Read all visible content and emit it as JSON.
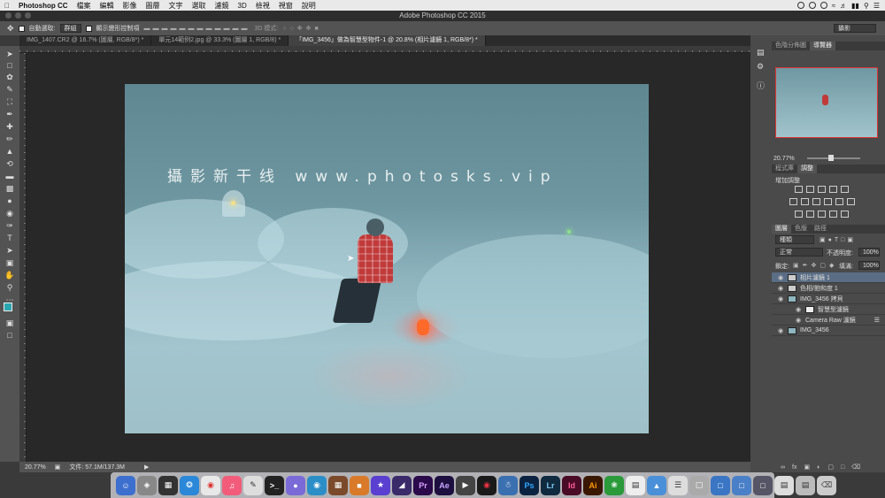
{
  "menubar": {
    "app_name": "Photoshop CC",
    "items": [
      "檔案",
      "編輯",
      "影像",
      "圖層",
      "文字",
      "選取",
      "濾鏡",
      "3D",
      "檢視",
      "視窗",
      "說明"
    ]
  },
  "window": {
    "title": "Adobe Photoshop CC 2015"
  },
  "options_bar": {
    "auto_select_label": "自動選取:",
    "auto_select_value": "群組",
    "transform_controls_label": "顯示變形控制項",
    "mode_3d_label": "3D 模式:",
    "workspace": "攝影"
  },
  "tabs": [
    {
      "label": "IMG_1407.CR2 @ 16.7% (圖層, RGB/8*) *"
    },
    {
      "label": "單元14範例2.jpg @ 33.3% (圖層 1, RGB/8) *"
    },
    {
      "label": "「IMG_3456」做為智慧型物件-1 @ 20.8% (相片濾鏡 1, RGB/8*) *"
    }
  ],
  "canvas": {
    "watermark": "攝影新干线 www.photosks.vip"
  },
  "status": {
    "zoom": "20.77%",
    "doc_label": "文件: 57.1M/137.3M"
  },
  "navigator": {
    "tabs": [
      "色階分佈圖",
      "導覽器"
    ],
    "zoom": "20.77%"
  },
  "adjustments": {
    "tabs": [
      "程式庫",
      "調整"
    ],
    "heading": "增加調整"
  },
  "layers_panel": {
    "tabs": [
      "圖層",
      "色版",
      "路徑"
    ],
    "kind_label": "種類",
    "blend_mode": "正常",
    "opacity_label": "不透明度:",
    "opacity": "100%",
    "lock_label": "鎖定:",
    "fill_label": "填滿:",
    "fill": "100%",
    "layers": [
      {
        "name": "相片濾鏡 1",
        "active": true
      },
      {
        "name": "色相/飽和度 1",
        "active": false
      },
      {
        "name": "IMG_3456 拷貝",
        "active": false
      },
      {
        "name": "智慧型濾鏡",
        "active": false
      },
      {
        "name": "Camera Raw 濾鏡",
        "active": false
      },
      {
        "name": "IMG_3456",
        "active": false
      }
    ]
  },
  "dock": {
    "apps": [
      {
        "label": "Pr",
        "color": "#2a0a4a"
      },
      {
        "label": "Ae",
        "color": "#1d0f3f"
      },
      {
        "label": "Ps",
        "color": "#0b2340"
      },
      {
        "label": "Lr",
        "color": "#102a40"
      },
      {
        "label": "Id",
        "color": "#4a0b26"
      },
      {
        "label": "Ai",
        "color": "#3a1800"
      }
    ]
  }
}
